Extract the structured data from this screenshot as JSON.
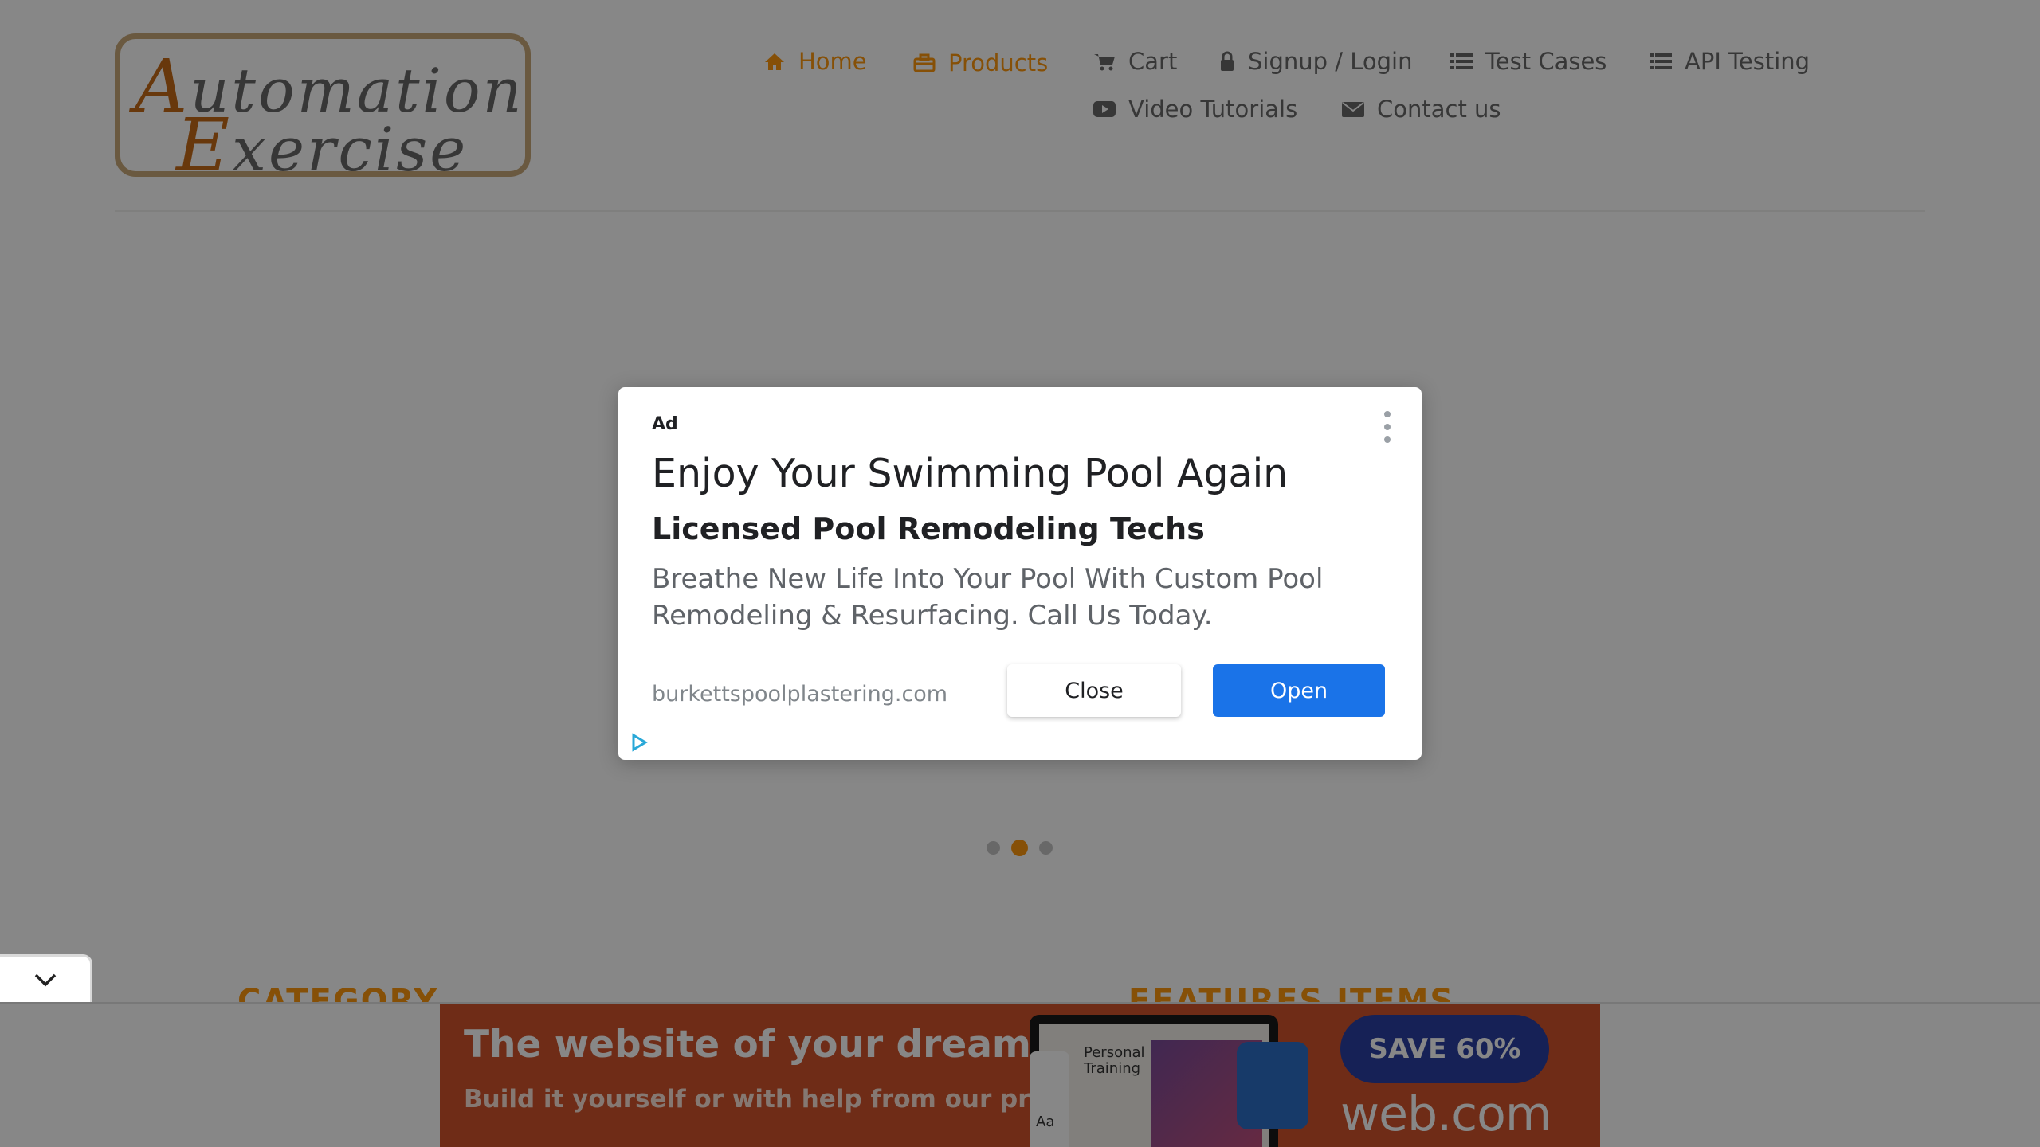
{
  "site": {
    "logo_line1_cap": "A",
    "logo_line1_rest": "utomation",
    "logo_line2_cap": "E",
    "logo_line2_rest": "xercise"
  },
  "nav": {
    "items": [
      {
        "label": "Home",
        "icon": "home-icon",
        "active": true
      },
      {
        "label": "Products",
        "icon": "briefcase-icon",
        "active": true
      },
      {
        "label": "Cart",
        "icon": "cart-icon"
      },
      {
        "label": "Signup / Login",
        "icon": "lock-icon"
      },
      {
        "label": "Test Cases",
        "icon": "list-icon"
      },
      {
        "label": "API Testing",
        "icon": "list-icon"
      },
      {
        "label": "Video Tutorials",
        "icon": "youtube-icon"
      },
      {
        "label": "Contact us",
        "icon": "envelope-icon"
      }
    ]
  },
  "slider": {
    "dot_count": 3,
    "active_dot": 2
  },
  "sections": {
    "category_title": "CATEGORY",
    "features_title": "FEATURES ITEMS"
  },
  "ad": {
    "label": "Ad",
    "title": "Enjoy Your Swimming Pool Again",
    "subtitle": "Licensed Pool Remodeling Techs",
    "body": "Breathe New Life Into Your Pool With Custom Pool Remodeling & Resurfacing. Call Us Today.",
    "domain": "burkettspoolplastering.com",
    "close_label": "Close",
    "open_label": "Open",
    "open_color": "#1a73e8"
  },
  "banner": {
    "title": "The website of your dreams",
    "subtitle": "Build it yourself or with help from our pros",
    "offer": "SAVE 60%",
    "brand": "web.com",
    "screen_text": "Personal Training",
    "panel_text": "Aa",
    "background": "#d2542d"
  },
  "colors": {
    "accent": "#fe980f",
    "nav_text": "#696969",
    "overlay": "rgba(0,0,0,0.47)"
  }
}
